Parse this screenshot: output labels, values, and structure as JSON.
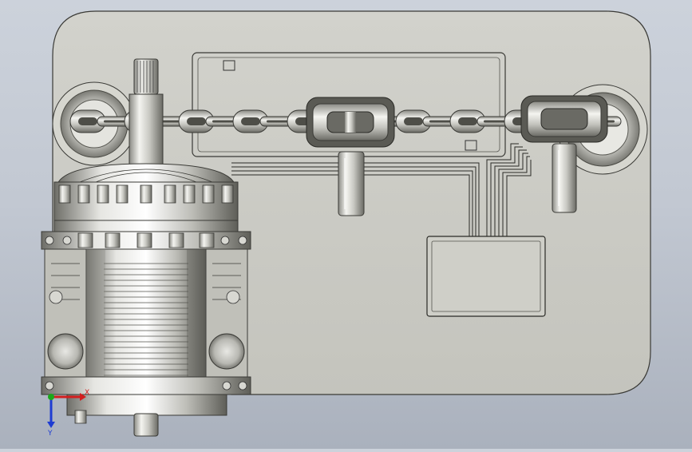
{
  "viewport": {
    "background_top": "#ccd2db",
    "background_bottom": "#aab1bd",
    "plate_color": "#c9c9c2",
    "metal_light": "#f2f2ee",
    "metal_dark": "#6e6e68"
  },
  "triad": {
    "x_label": "X",
    "y_label": "Y",
    "x_color": "#d21e1e",
    "y_color": "#1e3cd2",
    "origin_color": "#1aa81a"
  }
}
